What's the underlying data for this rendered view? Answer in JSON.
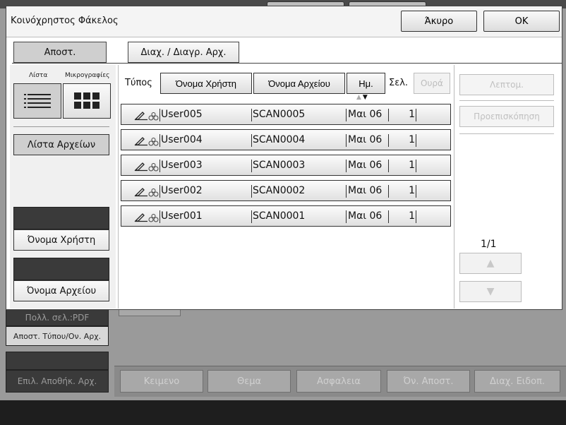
{
  "dialog": {
    "title": "Κοινόχρηστος Φάκελος",
    "cancel_label": "Άκυρο",
    "ok_label": "OK"
  },
  "tabs": [
    {
      "label": "Αποστ.",
      "active": true
    },
    {
      "label": "Διαχ. / Διαγρ. Αρχ.",
      "active": false
    }
  ],
  "left_panel": {
    "list_label": "Λίστα",
    "thumbnails_label": "Μικρογραφίες",
    "file_list_label": "Λίστα Αρχείων",
    "user_name_label": "Όνομα Χρήστη",
    "file_name_label": "Όνομα Αρχείου"
  },
  "columns": {
    "type_label": "Τύπος",
    "user_name": "Όνομα Χρήστη",
    "file_name": "Όνομα Αρχείου",
    "date": "Ημ.",
    "pages": "Σελ.",
    "queue": "Ουρά"
  },
  "files": [
    {
      "user": "User005",
      "file": "SCAN0005",
      "date": "Μαι 06",
      "pages": "1"
    },
    {
      "user": "User004",
      "file": "SCAN0004",
      "date": "Μαι 06",
      "pages": "1"
    },
    {
      "user": "User003",
      "file": "SCAN0003",
      "date": "Μαι 06",
      "pages": "1"
    },
    {
      "user": "User002",
      "file": "SCAN0002",
      "date": "Μαι 06",
      "pages": "1"
    },
    {
      "user": "User001",
      "file": "SCAN0001",
      "date": "Μαι 06",
      "pages": "1"
    }
  ],
  "right_panel": {
    "details_label": "Λεπτομ.",
    "preview_label": "Προεπισκόπηση",
    "page_count": "1/1",
    "up_glyph": "▲",
    "down_glyph": "▼"
  },
  "background": {
    "multi_page_pdf": "Πολλ. σελ.:PDF",
    "send_type_name": "Αποστ. Τύπου/Ον. Αρχ.",
    "select_store_file": "Επιλ. Αποθήκ. Αρχ.",
    "tabs": [
      "Κειμενο",
      "Θεμα",
      "Ασφαλεια",
      "Όν. Αποστ.",
      "Διαχ. Ειδοπ."
    ]
  },
  "colors": {
    "dialog_bg": "#ffffff",
    "active_tab": "#cfcfcf",
    "background": "#9a9a9a"
  }
}
